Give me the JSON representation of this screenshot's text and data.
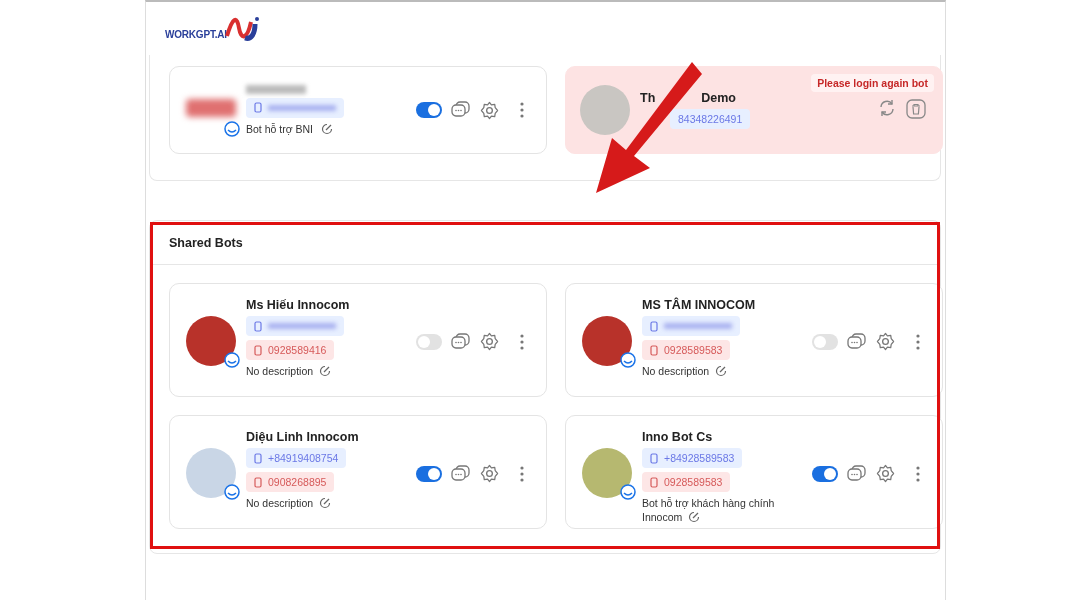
{
  "logo": {
    "text": "WORKGPT.AI"
  },
  "my_bots": [
    {
      "kind": "active",
      "avatar": {
        "kind": "blurred-logo"
      },
      "name_blurred": true,
      "phones": [
        {
          "kind": "primary",
          "blurred": true
        }
      ],
      "description": "Bot hỗ trợ BNI",
      "enabled": true
    },
    {
      "kind": "expired",
      "avatar": {
        "kind": "photo"
      },
      "name_parts": [
        "Th",
        "Demo"
      ],
      "phones": [
        {
          "kind": "primary",
          "text": "84348226491"
        }
      ],
      "alert": "Please login again bot"
    }
  ],
  "shared_bots": {
    "title": "Shared Bots",
    "bots": [
      {
        "kind": "active",
        "avatar": {
          "kind": "photo"
        },
        "name": "Ms Hiếu Innocom",
        "phones": [
          {
            "kind": "primary",
            "blurred": true
          },
          {
            "kind": "secondary",
            "text": "0928589416"
          }
        ],
        "description": "No description",
        "enabled": false
      },
      {
        "kind": "active",
        "avatar": {
          "kind": "photo"
        },
        "name": "MS TÂM INNOCOM",
        "phones": [
          {
            "kind": "primary",
            "blurred": true
          },
          {
            "kind": "secondary",
            "text": "0928589583"
          }
        ],
        "description": "No description",
        "enabled": false
      },
      {
        "kind": "active",
        "avatar": {
          "kind": "photo"
        },
        "name": "Diệu Linh Innocom",
        "phones": [
          {
            "kind": "primary",
            "text": "+84919408754"
          },
          {
            "kind": "secondary",
            "text": "0908268895"
          }
        ],
        "description": "No description",
        "enabled": true
      },
      {
        "kind": "active",
        "avatar": {
          "kind": "photo"
        },
        "name": "Inno Bot Cs",
        "phones": [
          {
            "kind": "primary",
            "text": "+84928589583"
          },
          {
            "kind": "secondary",
            "text": "0928589583"
          }
        ],
        "description": "Bot hỗ trợ khách hàng chính Innocom",
        "enabled": true
      }
    ]
  }
}
